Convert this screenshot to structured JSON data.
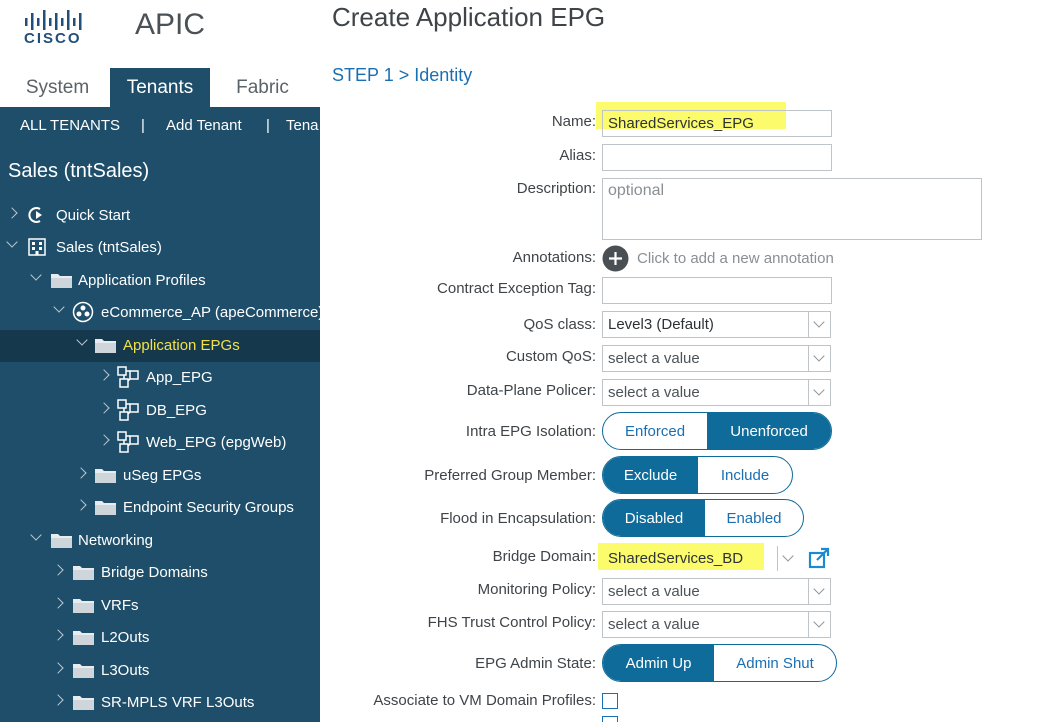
{
  "app": {
    "brand": "CISCO",
    "title": "APIC"
  },
  "top_tabs": [
    {
      "label": "System",
      "active": false
    },
    {
      "label": "Tenants",
      "active": true
    },
    {
      "label": "Fabric",
      "active": false
    }
  ],
  "subnav": {
    "all_tenants": "ALL TENANTS",
    "sep1": "|",
    "add_tenant": "Add Tenant",
    "sep2": "|",
    "tenant_search": "Tena"
  },
  "tenant_heading": "Sales (tntSales)",
  "tree": [
    {
      "label": "Quick Start",
      "icon": "quick-start-icon"
    },
    {
      "label": "Sales (tntSales)",
      "icon": "tenant-icon"
    },
    {
      "label": "Application Profiles",
      "icon": "folder-icon"
    },
    {
      "label": "eCommerce_AP (apeCommerce)",
      "icon": "app-profile-icon"
    },
    {
      "label": "Application EPGs",
      "icon": "folder-icon",
      "selected": true
    },
    {
      "label": "App_EPG",
      "icon": "epg-icon"
    },
    {
      "label": "DB_EPG",
      "icon": "epg-icon"
    },
    {
      "label": "Web_EPG (epgWeb)",
      "icon": "epg-icon"
    },
    {
      "label": "uSeg EPGs",
      "icon": "folder-icon"
    },
    {
      "label": "Endpoint Security Groups",
      "icon": "folder-icon"
    },
    {
      "label": "Networking",
      "icon": "folder-icon"
    },
    {
      "label": "Bridge Domains",
      "icon": "folder-icon"
    },
    {
      "label": "VRFs",
      "icon": "folder-icon"
    },
    {
      "label": "L2Outs",
      "icon": "folder-icon"
    },
    {
      "label": "L3Outs",
      "icon": "folder-icon"
    },
    {
      "label": "SR-MPLS VRF L3Outs",
      "icon": "folder-icon"
    }
  ],
  "dialog": {
    "title": "Create Application EPG",
    "step": "STEP 1 > Identity",
    "labels": {
      "name": "Name:",
      "alias": "Alias:",
      "description": "Description:",
      "annotations": "Annotations:",
      "contract_exception_tag": "Contract Exception Tag:",
      "qos_class": "QoS class:",
      "custom_qos": "Custom QoS:",
      "data_plane_policer": "Data-Plane Policer:",
      "intra_epg_isolation": "Intra EPG Isolation:",
      "preferred_group_member": "Preferred Group Member:",
      "flood_in_encapsulation": "Flood in Encapsulation:",
      "bridge_domain": "Bridge Domain:",
      "monitoring_policy": "Monitoring Policy:",
      "fhs_trust_control_policy": "FHS Trust Control Policy:",
      "epg_admin_state": "EPG Admin State:",
      "associate_vm_domain_profiles": "Associate to VM Domain Profiles:"
    },
    "values": {
      "name": "SharedServices_EPG",
      "alias": "",
      "description_placeholder": "optional",
      "annotation_hint": "Click to add a new annotation",
      "contract_exception_tag": "",
      "qos_class": "Level3 (Default)",
      "custom_qos": "select a value",
      "data_plane_policer": "select a value",
      "bridge_domain": "SharedServices_BD",
      "monitoring_policy": "select a value",
      "fhs_trust_control_policy": "select a value"
    },
    "toggles": {
      "intra_epg_isolation": {
        "options": [
          "Enforced",
          "Unenforced"
        ],
        "selected": "Unenforced"
      },
      "preferred_group_member": {
        "options": [
          "Exclude",
          "Include"
        ],
        "selected": "Exclude"
      },
      "flood_in_encapsulation": {
        "options": [
          "Disabled",
          "Enabled"
        ],
        "selected": "Disabled"
      },
      "epg_admin_state": {
        "options": [
          "Admin Up",
          "Admin Shut"
        ],
        "selected": "Admin Up"
      }
    }
  },
  "colors": {
    "sidebar_bg": "#1f4e6a",
    "selected_text": "#f2e14a",
    "accent": "#0f6b99",
    "highlight": "#fbfb6b"
  }
}
